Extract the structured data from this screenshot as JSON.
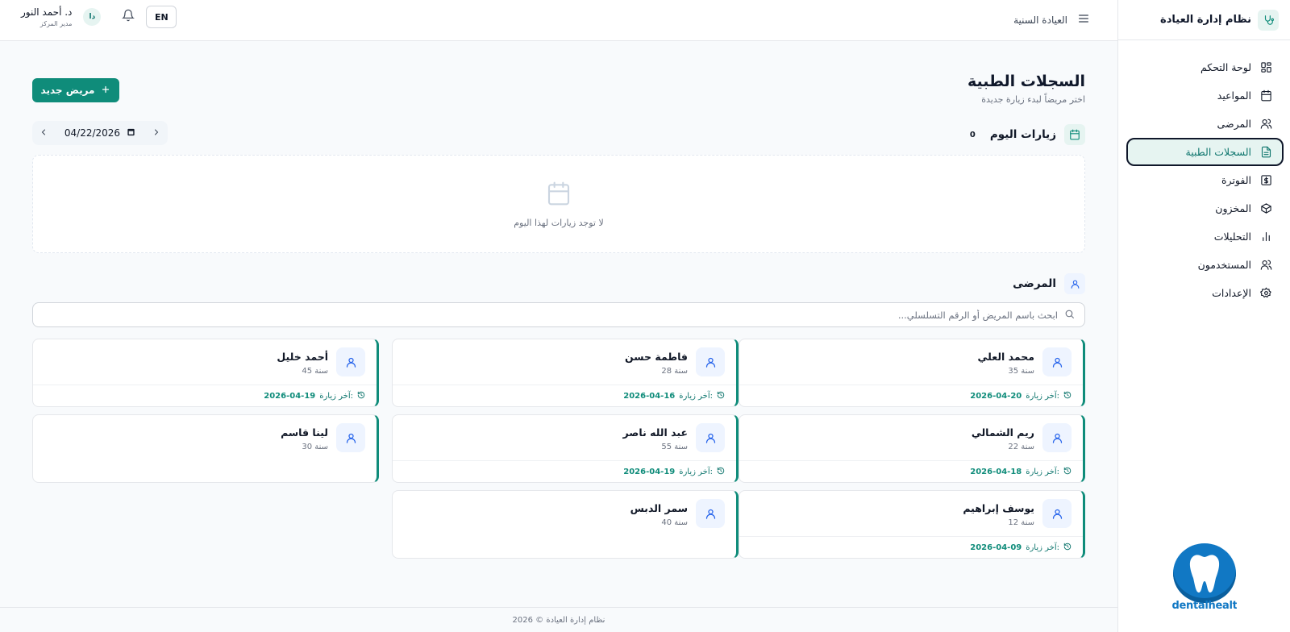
{
  "brand": {
    "title": "نظام إدارة العيادة"
  },
  "sidebar": {
    "items": [
      {
        "label": "لوحة التحكم",
        "icon": "dashboard-icon",
        "active": false
      },
      {
        "label": "المواعيد",
        "icon": "calendar-icon",
        "active": false
      },
      {
        "label": "المرضى",
        "icon": "users-icon",
        "active": false
      },
      {
        "label": "السجلات الطبية",
        "icon": "file-text-icon",
        "active": true
      },
      {
        "label": "الفوترة",
        "icon": "dollar-icon",
        "active": false
      },
      {
        "label": "المخزون",
        "icon": "package-icon",
        "active": false
      },
      {
        "label": "التحليلات",
        "icon": "bar-chart-icon",
        "active": false
      },
      {
        "label": "المستخدمون",
        "icon": "users-icon",
        "active": false
      },
      {
        "label": "الإعدادات",
        "icon": "gear-icon",
        "active": false
      }
    ],
    "logo_text": "dentalhealt"
  },
  "header": {
    "clinic_name": "العيادة السنية",
    "lang_label": "EN",
    "user_name": "د. أحمد النور",
    "user_role": "مدير المركز",
    "avatar_initials": "دا"
  },
  "main": {
    "title": "السجلات الطبية",
    "subtitle": "اختر مريضاً لبدء زيارة جديدة",
    "new_patient_label": "مريض جديد",
    "visits_title": "زيارات اليوم",
    "visits_count": "0",
    "date_value": "04/22/2026",
    "empty_text": "لا توجد زيارات لهذا اليوم",
    "patients_title": "المرضى",
    "search_placeholder": "ابحث باسم المريض أو الرقم التسلسلي...",
    "last_visit_label": "آخر زيارة:"
  },
  "patients": [
    {
      "name": "محمد العلي",
      "age": "35 سنة",
      "last_visit": "2026-04-20"
    },
    {
      "name": "فاطمة حسن",
      "age": "28 سنة",
      "last_visit": "2026-04-16"
    },
    {
      "name": "أحمد خليل",
      "age": "45 سنة",
      "last_visit": "2026-04-19"
    },
    {
      "name": "ريم الشمالي",
      "age": "22 سنة",
      "last_visit": "2026-04-18"
    },
    {
      "name": "عبد الله ناصر",
      "age": "55 سنة",
      "last_visit": "2026-04-19"
    },
    {
      "name": "لينا قاسم",
      "age": "30 سنة",
      "last_visit": ""
    },
    {
      "name": "يوسف إبراهيم",
      "age": "12 سنة",
      "last_visit": "2026-04-09"
    },
    {
      "name": "سمر الدبس",
      "age": "40 سنة",
      "last_visit": ""
    }
  ],
  "footer": {
    "text": "نظام إدارة العيادة © 2026"
  },
  "colors": {
    "accent": "#0f8c7a",
    "accent_light": "#e6f4f1",
    "logo": "#1178c4"
  }
}
